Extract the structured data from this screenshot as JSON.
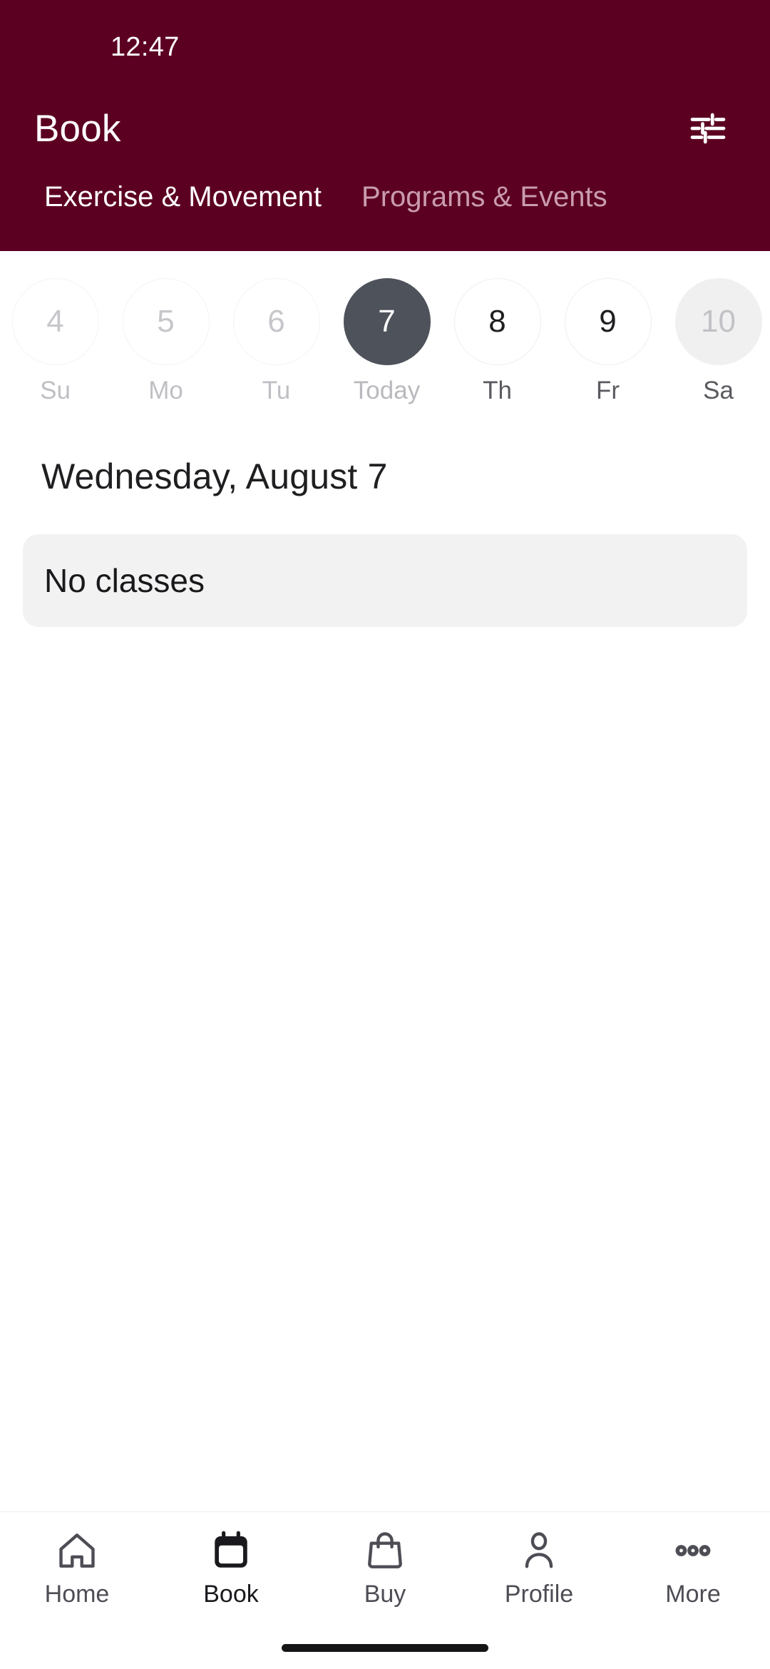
{
  "status_bar": {
    "time": "12:47"
  },
  "app_bar": {
    "title": "Book",
    "filter_icon": "tune-icon"
  },
  "tabs": [
    {
      "label": "Exercise & Movement",
      "active": true
    },
    {
      "label": "Programs & Events",
      "active": false
    }
  ],
  "date_strip": [
    {
      "day": "4",
      "label": "Su",
      "state": "disabled"
    },
    {
      "day": "5",
      "label": "Mo",
      "state": "disabled"
    },
    {
      "day": "6",
      "label": "Tu",
      "state": "disabled"
    },
    {
      "day": "7",
      "label": "Today",
      "state": "selected"
    },
    {
      "day": "8",
      "label": "Th",
      "state": "normal"
    },
    {
      "day": "9",
      "label": "Fr",
      "state": "normal"
    },
    {
      "day": "10",
      "label": "Sa",
      "state": "greyfill"
    }
  ],
  "content": {
    "date_heading": "Wednesday, August 7",
    "empty_card_text": "No classes"
  },
  "bottom_nav": [
    {
      "label": "Home",
      "icon": "house-icon",
      "active": false
    },
    {
      "label": "Book",
      "icon": "calendar-icon",
      "active": true
    },
    {
      "label": "Buy",
      "icon": "shopping-bag-icon",
      "active": false
    },
    {
      "label": "Profile",
      "icon": "person-icon",
      "active": false
    },
    {
      "label": "More",
      "icon": "ellipsis-icon",
      "active": false
    }
  ],
  "colors": {
    "header_maroon": "#5C0022",
    "tab_inactive": "#C99DAE",
    "selected_day": "#4E525A",
    "card_bg": "#F2F2F3",
    "text_primary": "#1F1F22"
  }
}
